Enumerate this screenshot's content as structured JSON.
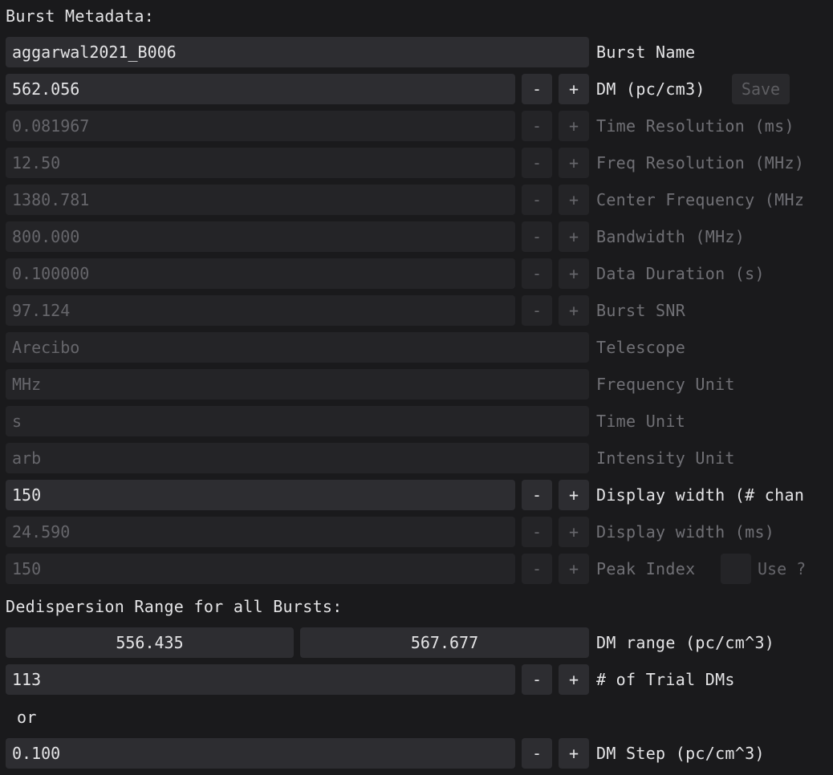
{
  "metadata": {
    "heading": "Burst Metadata:",
    "burst_name": {
      "value": "aggarwal2021_B006",
      "label": "Burst Name"
    },
    "dm": {
      "value": "562.056",
      "label": "DM (pc/cm3)",
      "save_label": "Save"
    },
    "time_resolution": {
      "value": "0.081967",
      "label": "Time Resolution (ms)"
    },
    "freq_resolution": {
      "value": "12.50",
      "label": "Freq Resolution (MHz)"
    },
    "center_frequency": {
      "value": "1380.781",
      "label": "Center Frequency (MHz"
    },
    "bandwidth": {
      "value": "800.000",
      "label": "Bandwidth (MHz)"
    },
    "data_duration": {
      "value": "0.100000",
      "label": "Data Duration (s)"
    },
    "burst_snr": {
      "value": "97.124",
      "label": "Burst SNR"
    },
    "telescope": {
      "value": "Arecibo",
      "label": "Telescope"
    },
    "frequency_unit": {
      "value": "MHz",
      "label": "Frequency Unit"
    },
    "time_unit": {
      "value": "s",
      "label": "Time Unit"
    },
    "intensity_unit": {
      "value": "arb",
      "label": "Intensity Unit"
    },
    "display_width_chan": {
      "value": "150",
      "label": "Display width (# chan"
    },
    "display_width_ms": {
      "value": "24.590",
      "label": "Display width (ms)"
    },
    "peak_index": {
      "value": "150",
      "label": "Peak Index",
      "use_label": "Use ?"
    }
  },
  "dedispersion": {
    "heading": "Dedispersion Range for all Bursts:",
    "dm_range": {
      "min": "556.435",
      "max": "567.677",
      "label": "DM range (pc/cm^3)"
    },
    "trial_dms": {
      "value": "113",
      "label": "# of Trial DMs"
    },
    "or_text": "or",
    "dm_step": {
      "value": "0.100",
      "label": "DM Step (pc/cm^3)"
    }
  },
  "buttons": {
    "minus": "-",
    "plus": "+"
  },
  "colors": {
    "background": "#1a1a1c",
    "field": "#2d2d31",
    "field_disabled": "#242427",
    "text": "#e4e4e6",
    "text_disabled": "#66666b"
  }
}
